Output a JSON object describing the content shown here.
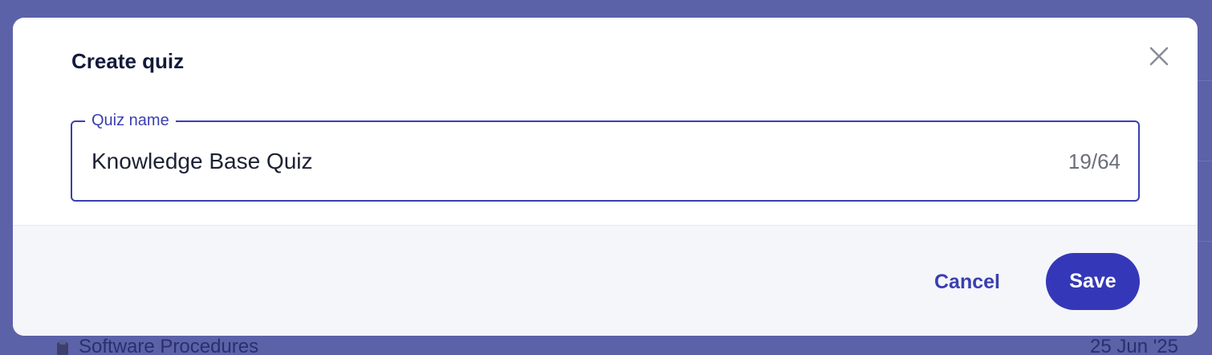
{
  "modal": {
    "title": "Create quiz",
    "close_icon": "close-icon"
  },
  "quiz_name_field": {
    "label": "Quiz name",
    "value": "Knowledge Base Quiz",
    "counter": "19/64"
  },
  "footer": {
    "cancel_label": "Cancel",
    "save_label": "Save"
  },
  "background_list": {
    "item_icon": "document-icon",
    "item_title": "Software Procedures",
    "item_date": "25 Jun '25"
  },
  "colors": {
    "overlay": "#5c62a8",
    "accent": "#3a3fb0",
    "save_button": "#3438b8",
    "footer_background": "#f5f6fa"
  }
}
